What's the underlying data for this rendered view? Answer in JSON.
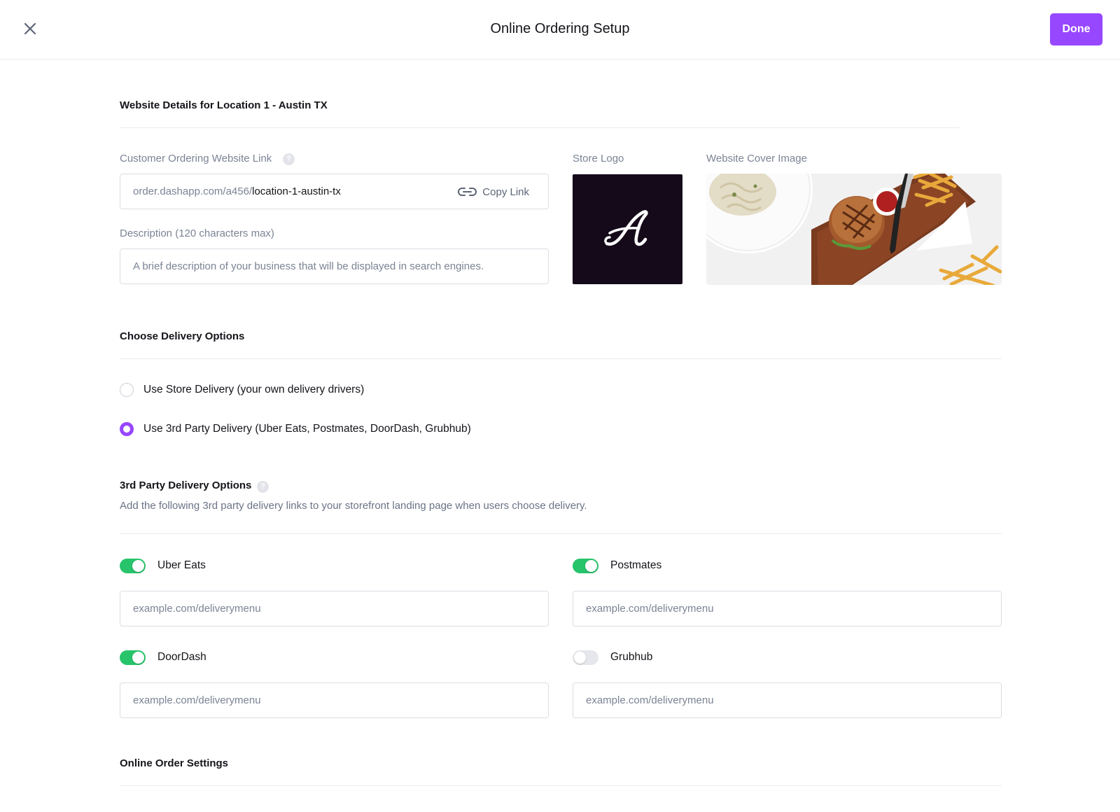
{
  "header": {
    "title": "Online Ordering Setup",
    "done_label": "Done"
  },
  "website": {
    "section_title": "Website Details for Location 1 - Austin TX",
    "link_label": "Customer Ordering Website Link",
    "link_prefix": "order.dashapp.com/a456/",
    "link_slug": "location-1-austin-tx",
    "copy_label": "Copy Link",
    "description_label": "Description (120 characters max)",
    "description_placeholder": "A brief description of your business that will be displayed in search engines.",
    "store_logo_label": "Store Logo",
    "cover_image_label": "Website Cover Image",
    "logo_letter": "A"
  },
  "delivery": {
    "section_title": "Choose Delivery Options",
    "options": [
      {
        "label": "Use Store Delivery (your own delivery drivers)",
        "selected": false
      },
      {
        "label": "Use 3rd Party Delivery (Uber Eats, Postmates, DoorDash, Grubhub)",
        "selected": true
      }
    ]
  },
  "third_party": {
    "section_title": "3rd Party Delivery Options",
    "subtitle": "Add the following 3rd party delivery links to your storefront landing page when users choose delivery.",
    "services": [
      {
        "name": "Uber Eats",
        "enabled": true,
        "placeholder": "example.com/deliverymenu"
      },
      {
        "name": "Postmates",
        "enabled": true,
        "placeholder": "example.com/deliverymenu"
      },
      {
        "name": "DoorDash",
        "enabled": true,
        "placeholder": "example.com/deliverymenu"
      },
      {
        "name": "Grubhub",
        "enabled": false,
        "placeholder": "example.com/deliverymenu"
      }
    ]
  },
  "order_settings": {
    "section_title": "Online Order Settings"
  },
  "colors": {
    "accent": "#9747ff",
    "toggle_on": "#27c46b",
    "toggle_off": "#e6e7ec",
    "logo_bg": "#150a1a"
  },
  "icons": {
    "close": "close-icon",
    "link": "link-icon",
    "help": "help-icon"
  }
}
